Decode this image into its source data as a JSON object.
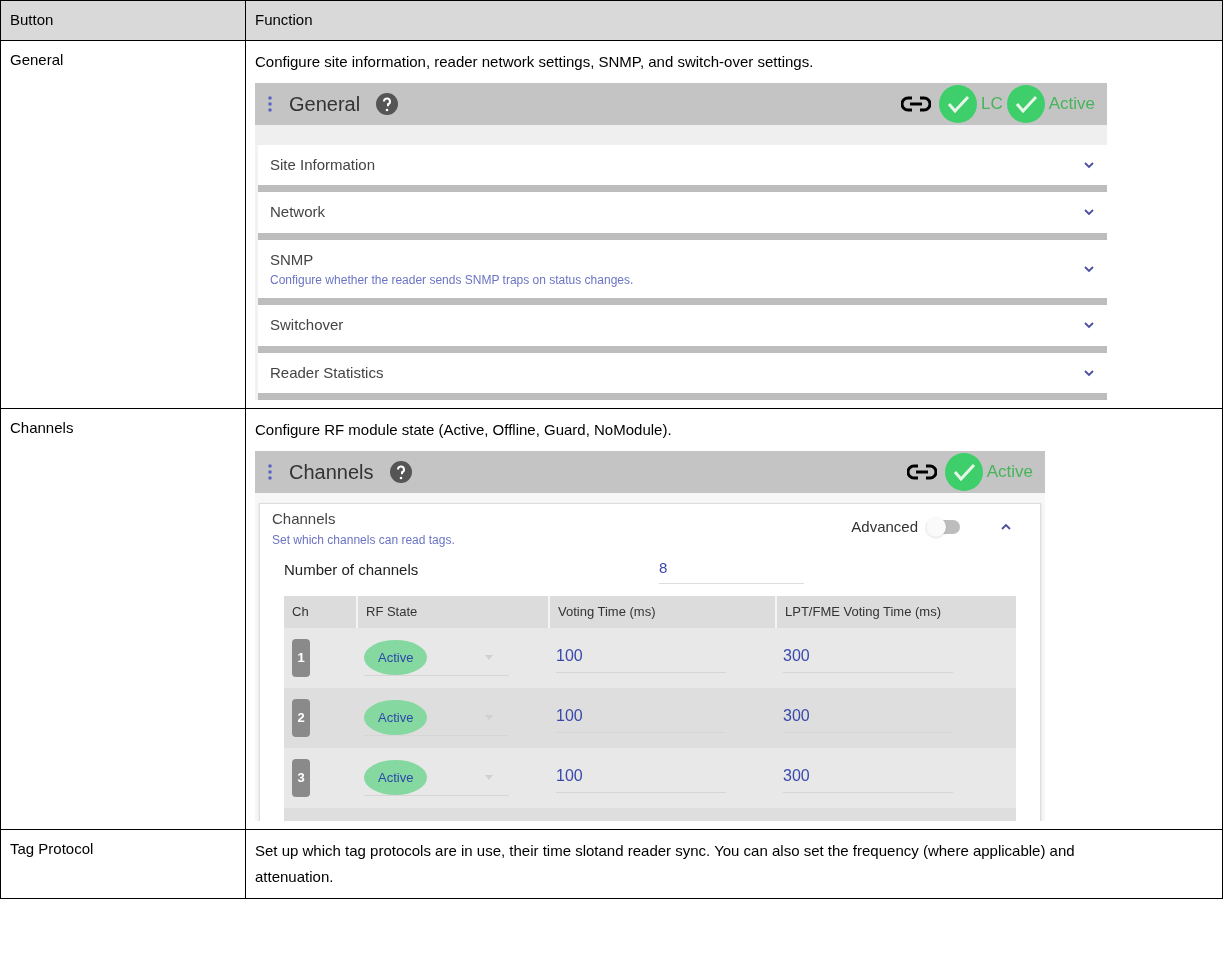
{
  "table": {
    "columns": [
      "Button",
      "Function"
    ],
    "rows": [
      {
        "button": "General",
        "function": "Configure site information, reader network settings, SNMP, and switch-over settings.",
        "panel": {
          "kind": "general",
          "title": "General",
          "status": [
            {
              "kind": "link"
            },
            {
              "kind": "check",
              "label": "LC"
            },
            {
              "kind": "check",
              "label": "Active"
            }
          ],
          "sections": [
            {
              "title": "Site Information",
              "expanded": false
            },
            {
              "title": "Network",
              "expanded": false
            },
            {
              "title": "SNMP",
              "subtitle": "Configure whether the reader sends SNMP traps on status changes.",
              "expanded": false
            },
            {
              "title": "Switchover",
              "expanded": false
            },
            {
              "title": "Reader Statistics",
              "expanded": false
            }
          ]
        }
      },
      {
        "button": "Channels",
        "function": "Configure RF module state (Active, Offline, Guard, NoModule).",
        "panel": {
          "kind": "channels",
          "title": "Channels",
          "status": [
            {
              "kind": "link"
            },
            {
              "kind": "check",
              "label": "Active"
            }
          ],
          "section": {
            "title": "Channels",
            "subtitle": "Set which channels can read tags.",
            "expanded": true,
            "advanced_label": "Advanced",
            "advanced_on": false,
            "number_label": "Number of channels",
            "number_value": "8",
            "columns": [
              "Ch",
              "RF State",
              "Voting Time (ms)",
              "LPT/FME Voting Time (ms)"
            ],
            "rows": [
              {
                "ch": "1",
                "rf_state": "Active",
                "voting": "100",
                "lpt": "300"
              },
              {
                "ch": "2",
                "rf_state": "Active",
                "voting": "100",
                "lpt": "300"
              },
              {
                "ch": "3",
                "rf_state": "Active",
                "voting": "100",
                "lpt": "300"
              }
            ]
          }
        }
      },
      {
        "button": "Tag Protocol",
        "function": "Set up which tag protocols are in use, their time slotand reader sync. You can also set the frequency (where applicable) and attenuation."
      }
    ]
  }
}
